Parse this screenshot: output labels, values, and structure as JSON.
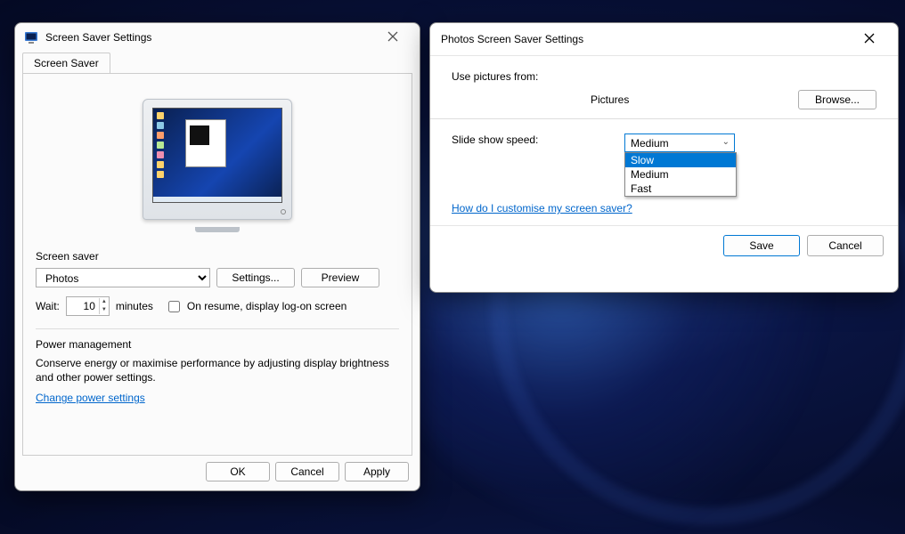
{
  "dlg1": {
    "title": "Screen Saver Settings",
    "tab_label": "Screen Saver",
    "section_label": "Screen saver",
    "screensaver_selected": "Photos",
    "settings_btn": "Settings...",
    "preview_btn": "Preview",
    "wait_label": "Wait:",
    "wait_value": "10",
    "minutes_label": "minutes",
    "resume_label": "On resume, display log-on screen",
    "power_section": "Power management",
    "power_desc": "Conserve energy or maximise performance by adjusting display brightness and other power settings.",
    "power_link": "Change power settings",
    "ok_btn": "OK",
    "cancel_btn": "Cancel",
    "apply_btn": "Apply"
  },
  "dlg2": {
    "title": "Photos Screen Saver Settings",
    "use_from_label": "Use pictures from:",
    "pictures_value": "Pictures",
    "browse_btn": "Browse...",
    "speed_label": "Slide show speed:",
    "speed_selected": "Medium",
    "options": {
      "slow": "Slow",
      "medium": "Medium",
      "fast": "Fast"
    },
    "help_link": "How do I customise my screen saver?",
    "save_btn": "Save",
    "cancel_btn": "Cancel"
  }
}
